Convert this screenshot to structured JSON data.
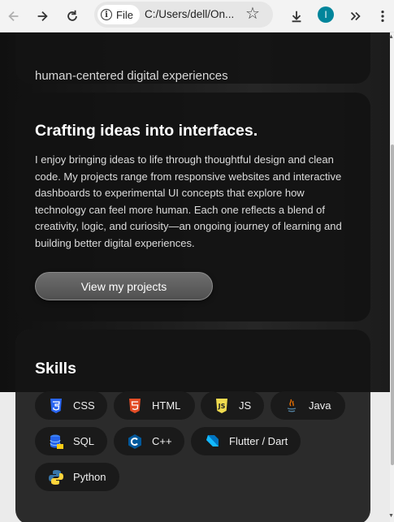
{
  "browser": {
    "address_chip": "File",
    "url": "C:/Users/dell/On...",
    "profile_initial": "I"
  },
  "hero": {
    "subtitle": "human-centered digital experiences"
  },
  "about": {
    "title": "Crafting ideas into interfaces.",
    "body": "I enjoy bringing ideas to life through thoughtful design and clean code. My projects range from responsive websites and interactive dashboards to experimental UI concepts that explore how technology can feel more human. Each one reflects a blend of creativity, logic, and curiosity—an ongoing journey of learning and building better digital experiences.",
    "button_label": "View my projects"
  },
  "skills": {
    "title": "Skills",
    "items": [
      {
        "label": "CSS",
        "icon": "css3-icon",
        "color": "#2965f1"
      },
      {
        "label": "HTML",
        "icon": "html5-icon",
        "color": "#e44d26"
      },
      {
        "label": "JS",
        "icon": "javascript-icon",
        "color": "#f0db4f"
      },
      {
        "label": "Java",
        "icon": "java-icon",
        "color": "#e76f00"
      },
      {
        "label": "SQL",
        "icon": "database-icon",
        "color": "#3b82f6"
      },
      {
        "label": "C++",
        "icon": "cplusplus-icon",
        "color": "#00599c"
      },
      {
        "label": "Flutter / Dart",
        "icon": "dart-icon",
        "color": "#0175c2"
      },
      {
        "label": "Python",
        "icon": "python-icon",
        "color": "#3776ab"
      }
    ]
  }
}
